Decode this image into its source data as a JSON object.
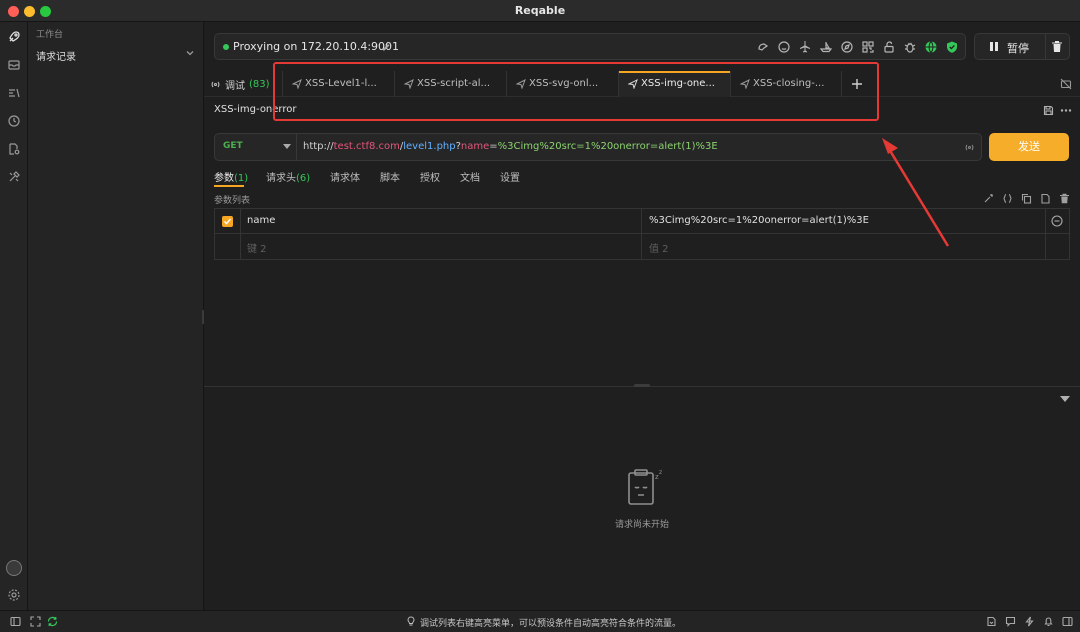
{
  "window": {
    "title": "Reqable"
  },
  "sidebar": {
    "section": "工作台",
    "item": "请求记录"
  },
  "proxy": {
    "text": "Proxying on 172.20.10.4:9001",
    "pause_label": "暂停"
  },
  "tabs": {
    "debug_label": "调试",
    "debug_count": "(83)",
    "items": [
      {
        "label": "XSS-Level1-l..."
      },
      {
        "label": "XSS-script-al..."
      },
      {
        "label": "XSS-svg-onl..."
      },
      {
        "label": "XSS-img-one..."
      },
      {
        "label": "XSS-closing-..."
      }
    ],
    "active_index": 3
  },
  "request": {
    "name": "XSS-img-onerror",
    "method": "GET",
    "url": {
      "scheme": "http://",
      "host": "test.ctf8.com",
      "path_sep": "/",
      "path": "level1.php",
      "q": "?",
      "key": "name",
      "eq": "=",
      "value": "%3Cimg%20src=1%20onerror=alert(1)%3E"
    },
    "send_label": "发送"
  },
  "subtabs": [
    {
      "label": "参数",
      "count": "(1)"
    },
    {
      "label": "请求头",
      "count": "(6)"
    },
    {
      "label": "请求体"
    },
    {
      "label": "脚本"
    },
    {
      "label": "授权"
    },
    {
      "label": "文档"
    },
    {
      "label": "设置"
    }
  ],
  "params": {
    "list_label": "参数列表",
    "rows": [
      {
        "checked": true,
        "key": "name",
        "value": "%3Cimg%20src=1%20onerror=alert(1)%3E"
      }
    ],
    "key_placeholder": "键 2",
    "value_placeholder": "值 2"
  },
  "response": {
    "empty_text": "请求尚未开始"
  },
  "status": {
    "hint": "调试列表右键高亮菜单，可以预设条件自动高亮符合条件的流量。"
  },
  "colors": {
    "accent": "#f5a623",
    "send_button": "#f5ad2a",
    "proxy_on": "#34c759",
    "highlight": "#e53935"
  }
}
